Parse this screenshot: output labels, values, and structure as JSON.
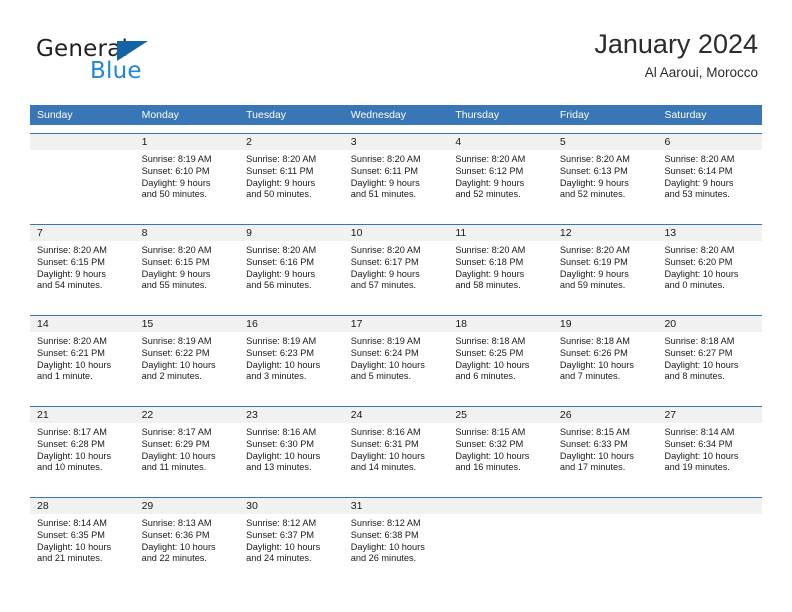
{
  "brand": {
    "name_part1": "General",
    "name_part2": "Blue",
    "triangle_color": "#1264a3",
    "blue_color": "#1e87d6"
  },
  "header": {
    "title": "January 2024",
    "subtitle": "Al Aaroui, Morocco"
  },
  "colors": {
    "header_row_bg": "#3876b5",
    "date_band_bg": "#f1f1f1",
    "separator": "#3876b5",
    "text": "#1a1a1a"
  },
  "weekday_headers": [
    "Sunday",
    "Monday",
    "Tuesday",
    "Wednesday",
    "Thursday",
    "Friday",
    "Saturday"
  ],
  "weeks": [
    {
      "days": [
        {
          "date": "",
          "sunrise": "",
          "sunset": "",
          "daylight_line1": "",
          "daylight_line2": ""
        },
        {
          "date": "1",
          "sunrise": "Sunrise: 8:19 AM",
          "sunset": "Sunset: 6:10 PM",
          "daylight_line1": "Daylight: 9 hours",
          "daylight_line2": "and 50 minutes."
        },
        {
          "date": "2",
          "sunrise": "Sunrise: 8:20 AM",
          "sunset": "Sunset: 6:11 PM",
          "daylight_line1": "Daylight: 9 hours",
          "daylight_line2": "and 50 minutes."
        },
        {
          "date": "3",
          "sunrise": "Sunrise: 8:20 AM",
          "sunset": "Sunset: 6:11 PM",
          "daylight_line1": "Daylight: 9 hours",
          "daylight_line2": "and 51 minutes."
        },
        {
          "date": "4",
          "sunrise": "Sunrise: 8:20 AM",
          "sunset": "Sunset: 6:12 PM",
          "daylight_line1": "Daylight: 9 hours",
          "daylight_line2": "and 52 minutes."
        },
        {
          "date": "5",
          "sunrise": "Sunrise: 8:20 AM",
          "sunset": "Sunset: 6:13 PM",
          "daylight_line1": "Daylight: 9 hours",
          "daylight_line2": "and 52 minutes."
        },
        {
          "date": "6",
          "sunrise": "Sunrise: 8:20 AM",
          "sunset": "Sunset: 6:14 PM",
          "daylight_line1": "Daylight: 9 hours",
          "daylight_line2": "and 53 minutes."
        }
      ]
    },
    {
      "days": [
        {
          "date": "7",
          "sunrise": "Sunrise: 8:20 AM",
          "sunset": "Sunset: 6:15 PM",
          "daylight_line1": "Daylight: 9 hours",
          "daylight_line2": "and 54 minutes."
        },
        {
          "date": "8",
          "sunrise": "Sunrise: 8:20 AM",
          "sunset": "Sunset: 6:15 PM",
          "daylight_line1": "Daylight: 9 hours",
          "daylight_line2": "and 55 minutes."
        },
        {
          "date": "9",
          "sunrise": "Sunrise: 8:20 AM",
          "sunset": "Sunset: 6:16 PM",
          "daylight_line1": "Daylight: 9 hours",
          "daylight_line2": "and 56 minutes."
        },
        {
          "date": "10",
          "sunrise": "Sunrise: 8:20 AM",
          "sunset": "Sunset: 6:17 PM",
          "daylight_line1": "Daylight: 9 hours",
          "daylight_line2": "and 57 minutes."
        },
        {
          "date": "11",
          "sunrise": "Sunrise: 8:20 AM",
          "sunset": "Sunset: 6:18 PM",
          "daylight_line1": "Daylight: 9 hours",
          "daylight_line2": "and 58 minutes."
        },
        {
          "date": "12",
          "sunrise": "Sunrise: 8:20 AM",
          "sunset": "Sunset: 6:19 PM",
          "daylight_line1": "Daylight: 9 hours",
          "daylight_line2": "and 59 minutes."
        },
        {
          "date": "13",
          "sunrise": "Sunrise: 8:20 AM",
          "sunset": "Sunset: 6:20 PM",
          "daylight_line1": "Daylight: 10 hours",
          "daylight_line2": "and 0 minutes."
        }
      ]
    },
    {
      "days": [
        {
          "date": "14",
          "sunrise": "Sunrise: 8:20 AM",
          "sunset": "Sunset: 6:21 PM",
          "daylight_line1": "Daylight: 10 hours",
          "daylight_line2": "and 1 minute."
        },
        {
          "date": "15",
          "sunrise": "Sunrise: 8:19 AM",
          "sunset": "Sunset: 6:22 PM",
          "daylight_line1": "Daylight: 10 hours",
          "daylight_line2": "and 2 minutes."
        },
        {
          "date": "16",
          "sunrise": "Sunrise: 8:19 AM",
          "sunset": "Sunset: 6:23 PM",
          "daylight_line1": "Daylight: 10 hours",
          "daylight_line2": "and 3 minutes."
        },
        {
          "date": "17",
          "sunrise": "Sunrise: 8:19 AM",
          "sunset": "Sunset: 6:24 PM",
          "daylight_line1": "Daylight: 10 hours",
          "daylight_line2": "and 5 minutes."
        },
        {
          "date": "18",
          "sunrise": "Sunrise: 8:18 AM",
          "sunset": "Sunset: 6:25 PM",
          "daylight_line1": "Daylight: 10 hours",
          "daylight_line2": "and 6 minutes."
        },
        {
          "date": "19",
          "sunrise": "Sunrise: 8:18 AM",
          "sunset": "Sunset: 6:26 PM",
          "daylight_line1": "Daylight: 10 hours",
          "daylight_line2": "and 7 minutes."
        },
        {
          "date": "20",
          "sunrise": "Sunrise: 8:18 AM",
          "sunset": "Sunset: 6:27 PM",
          "daylight_line1": "Daylight: 10 hours",
          "daylight_line2": "and 8 minutes."
        }
      ]
    },
    {
      "days": [
        {
          "date": "21",
          "sunrise": "Sunrise: 8:17 AM",
          "sunset": "Sunset: 6:28 PM",
          "daylight_line1": "Daylight: 10 hours",
          "daylight_line2": "and 10 minutes."
        },
        {
          "date": "22",
          "sunrise": "Sunrise: 8:17 AM",
          "sunset": "Sunset: 6:29 PM",
          "daylight_line1": "Daylight: 10 hours",
          "daylight_line2": "and 11 minutes."
        },
        {
          "date": "23",
          "sunrise": "Sunrise: 8:16 AM",
          "sunset": "Sunset: 6:30 PM",
          "daylight_line1": "Daylight: 10 hours",
          "daylight_line2": "and 13 minutes."
        },
        {
          "date": "24",
          "sunrise": "Sunrise: 8:16 AM",
          "sunset": "Sunset: 6:31 PM",
          "daylight_line1": "Daylight: 10 hours",
          "daylight_line2": "and 14 minutes."
        },
        {
          "date": "25",
          "sunrise": "Sunrise: 8:15 AM",
          "sunset": "Sunset: 6:32 PM",
          "daylight_line1": "Daylight: 10 hours",
          "daylight_line2": "and 16 minutes."
        },
        {
          "date": "26",
          "sunrise": "Sunrise: 8:15 AM",
          "sunset": "Sunset: 6:33 PM",
          "daylight_line1": "Daylight: 10 hours",
          "daylight_line2": "and 17 minutes."
        },
        {
          "date": "27",
          "sunrise": "Sunrise: 8:14 AM",
          "sunset": "Sunset: 6:34 PM",
          "daylight_line1": "Daylight: 10 hours",
          "daylight_line2": "and 19 minutes."
        }
      ]
    },
    {
      "days": [
        {
          "date": "28",
          "sunrise": "Sunrise: 8:14 AM",
          "sunset": "Sunset: 6:35 PM",
          "daylight_line1": "Daylight: 10 hours",
          "daylight_line2": "and 21 minutes."
        },
        {
          "date": "29",
          "sunrise": "Sunrise: 8:13 AM",
          "sunset": "Sunset: 6:36 PM",
          "daylight_line1": "Daylight: 10 hours",
          "daylight_line2": "and 22 minutes."
        },
        {
          "date": "30",
          "sunrise": "Sunrise: 8:12 AM",
          "sunset": "Sunset: 6:37 PM",
          "daylight_line1": "Daylight: 10 hours",
          "daylight_line2": "and 24 minutes."
        },
        {
          "date": "31",
          "sunrise": "Sunrise: 8:12 AM",
          "sunset": "Sunset: 6:38 PM",
          "daylight_line1": "Daylight: 10 hours",
          "daylight_line2": "and 26 minutes."
        },
        {
          "date": "",
          "sunrise": "",
          "sunset": "",
          "daylight_line1": "",
          "daylight_line2": ""
        },
        {
          "date": "",
          "sunrise": "",
          "sunset": "",
          "daylight_line1": "",
          "daylight_line2": ""
        },
        {
          "date": "",
          "sunrise": "",
          "sunset": "",
          "daylight_line1": "",
          "daylight_line2": ""
        }
      ]
    }
  ]
}
